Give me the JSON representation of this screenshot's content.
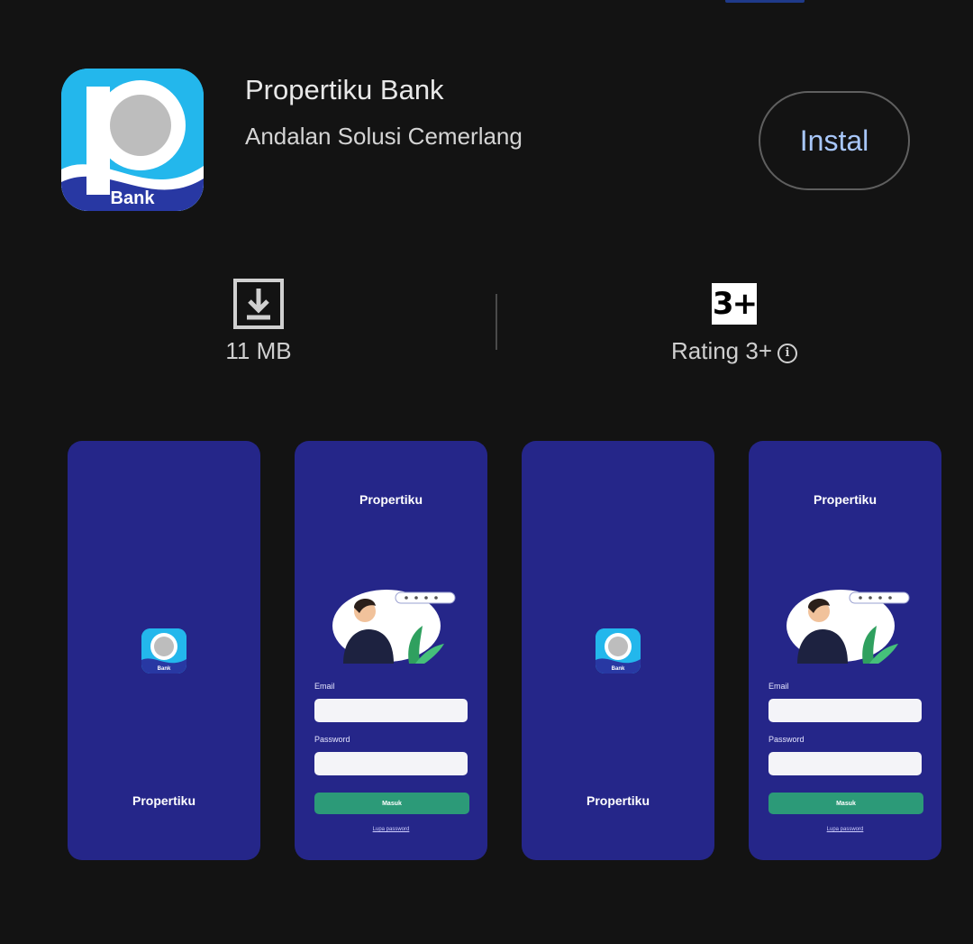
{
  "app": {
    "title": "Propertiku Bank",
    "developer": "Andalan Solusi Cemerlang",
    "icon_label": "Bank",
    "install_label": "Instal"
  },
  "stats": {
    "size": {
      "icon": "download-icon",
      "label": "11 MB"
    },
    "rating": {
      "badge": "3+",
      "label": "Rating 3+",
      "info_icon": "info-icon"
    }
  },
  "screenshots": [
    {
      "type": "splash",
      "brand": "Propertiku",
      "logo_label": "Bank"
    },
    {
      "type": "login",
      "brand": "Propertiku",
      "email_label": "Email",
      "password_label": "Password",
      "button_label": "Masuk",
      "link_label": "Lupa password"
    },
    {
      "type": "splash",
      "brand": "Propertiku",
      "logo_label": "Bank"
    },
    {
      "type": "login",
      "brand": "Propertiku",
      "email_label": "Email",
      "password_label": "Password",
      "button_label": "Masuk",
      "link_label": "Lupa password"
    }
  ],
  "colors": {
    "background": "#131313",
    "accent": "#a8c7fa",
    "screenshot_bg": "#252689",
    "login_button": "#2c9a78",
    "icon_blue": "#23b7ec"
  }
}
